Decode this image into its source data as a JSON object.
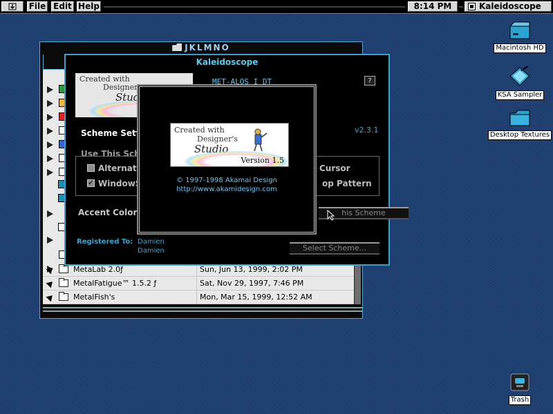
{
  "menubar": {
    "items": [
      "File",
      "Edit",
      "Help"
    ],
    "clock": "8:14 PM",
    "app_name": "Kaleidoscope"
  },
  "desktop": {
    "icons": [
      {
        "label": "Macintosh HD",
        "icon": "hard-disk-icon"
      },
      {
        "label": "KSA Sampler",
        "icon": "document-icon"
      },
      {
        "label": "Desktop Textures",
        "icon": "folder-icon"
      },
      {
        "label": "Trash",
        "icon": "trash-icon"
      }
    ]
  },
  "finder": {
    "title": "JKLMNO",
    "rows": [
      {
        "name": "MetaLab 2.0ƒ",
        "date": "Sun, Jun 13, 1999, 2:02 PM"
      },
      {
        "name": "MetalFatigue™ 1.5.2 ƒ",
        "date": "Sat, Nov 29, 1997, 7:46 PM"
      },
      {
        "name": "MetalFish's",
        "date": "Mon, Mar 15, 1999, 12:52 AM"
      }
    ]
  },
  "kaleidoscope": {
    "title": "Kaleidoscope",
    "manufacturer_text": "MET-ALOS I DT",
    "help": "?",
    "version": "v2.3.1",
    "scheme_heading": "Scheme Setti",
    "use_scheme_label": "Use This Sche",
    "check_alternate": "Alternate",
    "check_windows": "WindowS",
    "right_cursor": "Cursor",
    "right_pattern": "op Pattern",
    "accent_label": "Accent Color:",
    "registered_label": "Registered To:",
    "registered_name": "Damien",
    "registered_org": "Damien",
    "btn_scheme": "his Scheme",
    "btn_select": "Select Scheme..."
  },
  "logo": {
    "line1": "Created with",
    "line2": "Designer's",
    "line3": "Studio",
    "version": "Version 1.5"
  },
  "about": {
    "copyright": "© 1997-1998 Akamai Design",
    "url": "http://www.akamidesign.com"
  }
}
